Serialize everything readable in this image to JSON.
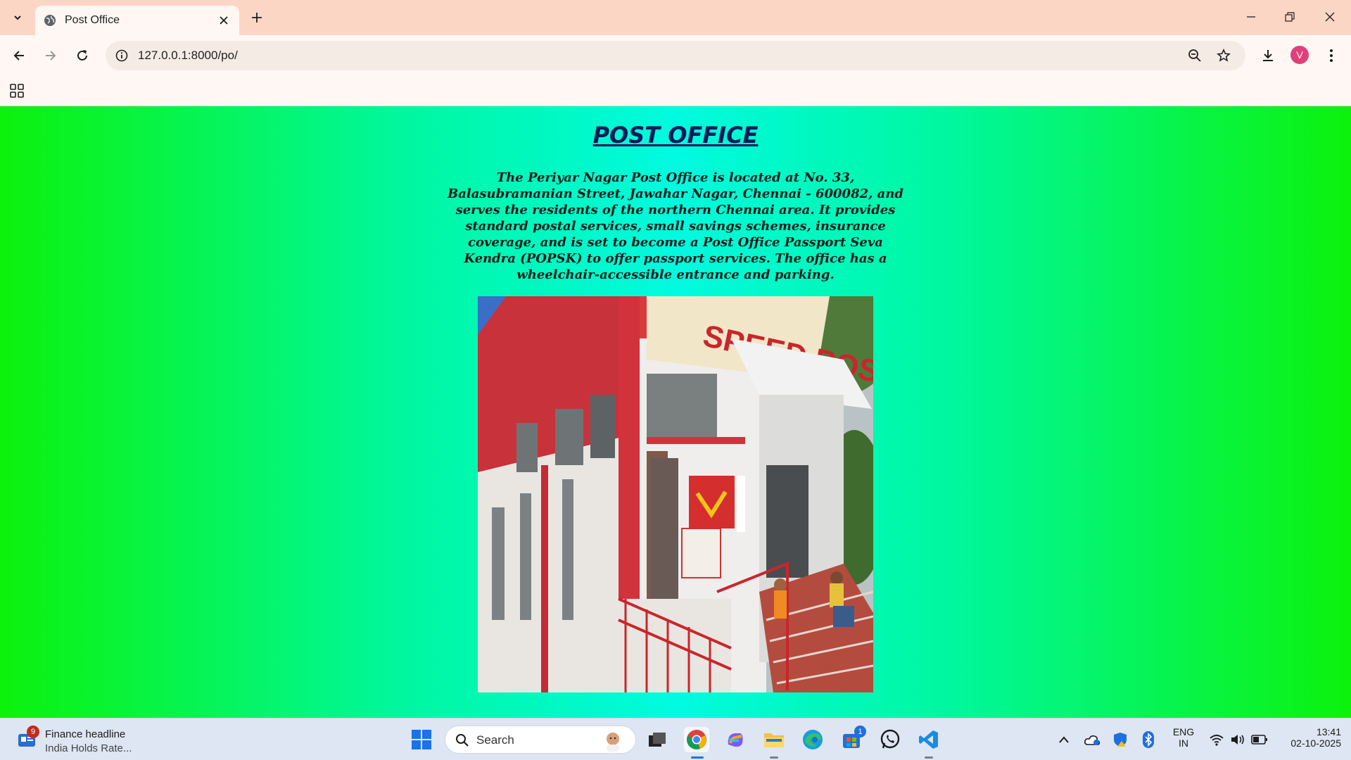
{
  "browser": {
    "tab_title": "Post Office",
    "url": "127.0.0.1:8000/po/",
    "profile_initial": "V"
  },
  "page": {
    "title": "POST OFFICE",
    "description": "The Periyar Nagar Post Office is located at No. 33, Balasubramanian Street, Jawahar Nagar, Chennai - 600082, and serves the residents of the northern Chennai area. It provides standard postal services, small savings schemes, insurance coverage, and is set to become a Post Office Passport Seva Kendra (POPSK) to offer passport services. The office has a wheelchair-accessible entrance and parking.",
    "photo_sign_text": "SPEED POST"
  },
  "taskbar": {
    "news_badge": "9",
    "news_headline": "Finance headline",
    "news_subtitle": "India Holds Rate...",
    "search_label": "Search",
    "store_badge": "1",
    "language_line1": "ENG",
    "language_line2": "IN",
    "time": "13:41",
    "date": "02-10-2025"
  },
  "colors": {
    "tabstrip": "#fcd6c4",
    "toolbar": "#fff7f3",
    "page_gradient_edge": "#0cf20c",
    "page_gradient_center": "#00fae0",
    "title_color": "#0b1a5a"
  }
}
